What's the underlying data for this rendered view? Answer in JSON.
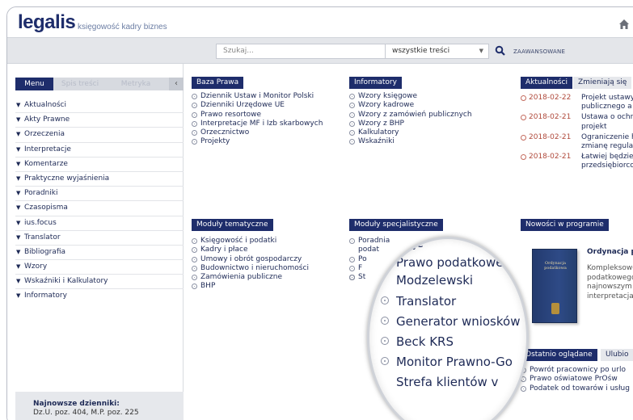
{
  "header": {
    "logo": "legalis",
    "tagline": "księgowość kadry biznes",
    "home_icon": "home-icon"
  },
  "search": {
    "placeholder": "Szukaj...",
    "scope": "wszystkie treści",
    "advanced": "ZAAWANSOWANE"
  },
  "sidebar": {
    "tabs": [
      "Menu",
      "Spis treści",
      "Metryka"
    ],
    "items": [
      "Aktualności",
      "Akty Prawne",
      "Orzeczenia",
      "Interpretacje",
      "Komentarze",
      "Praktyczne wyjaśnienia",
      "Poradniki",
      "Czasopisma",
      "ius.focus",
      "Translator",
      "Bibliografia",
      "Wzory",
      "Wskaźniki i Kalkulatory",
      "Informatory"
    ],
    "latest_title": "Najnowsze dzienniki:",
    "latest_text": "Dz.U. poz. 404, M.P. poz. 225"
  },
  "baza_prawa": {
    "title": "Baza Prawa",
    "items": [
      "Dziennik Ustaw i Monitor Polski",
      "Dzienniki Urzędowe UE",
      "Prawo resortowe",
      "Interpretacje MF i Izb skarbowych",
      "Orzecznictwo",
      "Projekty"
    ]
  },
  "informatory": {
    "title": "Informatory",
    "items": [
      "Wzory księgowe",
      "Wzory kadrowe",
      "Wzory z zamówień publicznych",
      "Wzory z BHP",
      "Kalkulatory",
      "Wskaźniki"
    ]
  },
  "aktualnosci": {
    "tabs": [
      "Aktualności",
      "Zmieniają się"
    ],
    "items": [
      {
        "date": "2018-02-22",
        "text": "Projekt ustawy\npublicznego a"
      },
      {
        "date": "2018-02-21",
        "text": "Ustawa o ochr\nprojekt"
      },
      {
        "date": "2018-02-21",
        "text": "Ograniczenie h\nzmianę regular"
      },
      {
        "date": "2018-02-21",
        "text": "Łatwiej będzie\nprzedsiębiorco"
      }
    ]
  },
  "moduly_tematyczne": {
    "title": "Moduły tematyczne",
    "items": [
      "Księgowość i podatki",
      "Kadry i płace",
      "Umowy i obrót gospodarczy",
      "Budownictwo i nieruchomości",
      "Zamówienia publiczne",
      "BHP"
    ]
  },
  "moduly_specjalistyczne": {
    "title": "Moduły specjalistyczne",
    "items": [
      "Poradnia",
      "podat",
      "Po",
      "F",
      "",
      "",
      "",
      "St"
    ]
  },
  "nowosci": {
    "title": "Nowości w programie",
    "book_label": "Ordynacja podatkowa",
    "promo_title": "Ordynacja poc",
    "promo_desc": "Kompleksowe\npodatkowego\nnajnowszym\ninterpretacjam"
  },
  "ostatnio": {
    "tabs": [
      "Ostatnio oglądane",
      "Ulubio"
    ],
    "items": [
      "Powrót pracownicy po urlo",
      "Prawo oświatowe PrOśw",
      "Podatek od towarów i usług"
    ]
  },
  "magnifier": {
    "top_fragment": "acje",
    "items": [
      "Prawo podatkowe",
      "Modzelewski",
      "Translator",
      "Generator wniosków",
      "Beck KRS",
      "Monitor Prawno-Go",
      "Strefa klientów v"
    ]
  }
}
